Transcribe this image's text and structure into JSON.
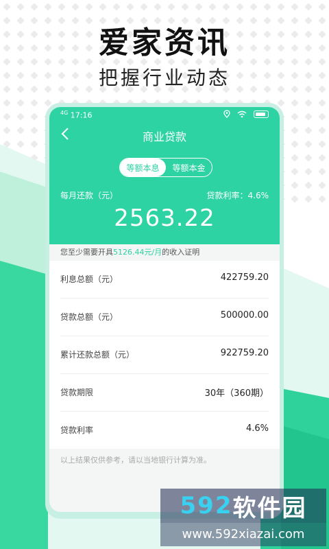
{
  "promo": {
    "title": "爱家资讯",
    "subtitle": "把握行业动态"
  },
  "status_bar": {
    "network": "4G",
    "time": "17:16"
  },
  "nav": {
    "title": "商业贷款"
  },
  "tabs": [
    {
      "label": "等额本息",
      "active": true
    },
    {
      "label": "等额本金",
      "active": false
    }
  ],
  "summary": {
    "monthly_label": "每月还款（元）",
    "rate_label": "贷款利率：4.6%",
    "monthly_amount": "2563.22"
  },
  "income_hint": {
    "prefix": "您至少需要开具",
    "value": "5126.44元/月",
    "suffix": "的收入证明"
  },
  "details": [
    {
      "label": "利息总额（元）",
      "value": "422759.20"
    },
    {
      "label": "贷款总额（元）",
      "value": "500000.00"
    },
    {
      "label": "累计还款总额（元）",
      "value": "922759.20"
    },
    {
      "label": "贷款期限",
      "value": "30年（360期）"
    },
    {
      "label": "贷款利率",
      "value": "4.6%"
    }
  ],
  "footer_note": "以上结果仅供参考，请以当地银行计算为准。",
  "watermark": {
    "number": "592",
    "brand": "软件园",
    "url": "www.592xiazai.com"
  },
  "colors": {
    "accent": "#2dd3a3"
  }
}
